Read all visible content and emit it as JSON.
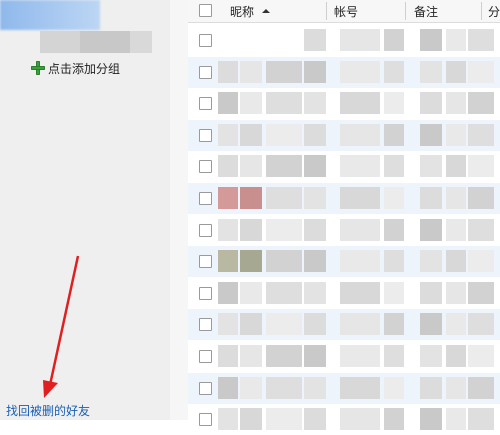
{
  "sidebar": {
    "add_group_label": "点击添加分组",
    "recover_link": "找回被删的好友"
  },
  "table": {
    "columns": [
      "昵称",
      "帐号",
      "备注",
      "分"
    ],
    "row_count": 13
  },
  "colors": {
    "link": "#1a5fb4",
    "plus": "#3aa13a",
    "arrow": "#e02020",
    "row_alt": "#eef4fb"
  }
}
